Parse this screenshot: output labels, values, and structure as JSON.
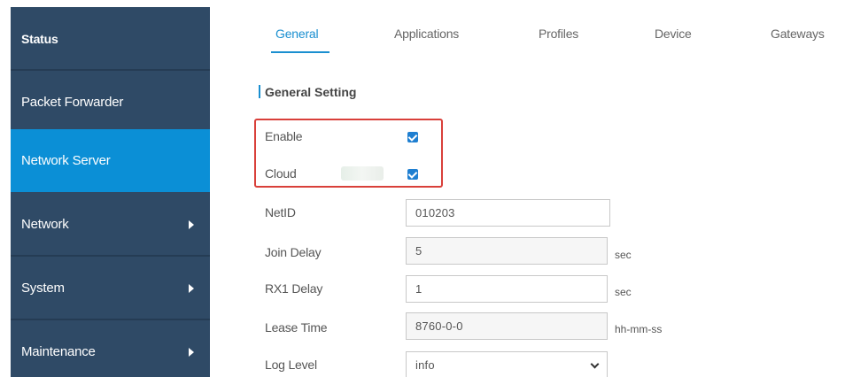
{
  "sidebar": {
    "items": [
      {
        "label": "Status"
      },
      {
        "label": "Packet Forwarder"
      },
      {
        "label": "Network Server"
      },
      {
        "label": "Network"
      },
      {
        "label": "System"
      },
      {
        "label": "Maintenance"
      }
    ]
  },
  "tabs": [
    "General",
    "Applications",
    "Profiles",
    "Device",
    "Gateways"
  ],
  "section": {
    "title": "General Setting"
  },
  "form": {
    "enable": {
      "label": "Enable",
      "checked": true
    },
    "cloud": {
      "label": "Cloud",
      "checked": true
    },
    "netid": {
      "label": "NetID",
      "value": "010203"
    },
    "join_delay": {
      "label": "Join Delay",
      "value": "5",
      "unit": "sec"
    },
    "rx1_delay": {
      "label": "RX1 Delay",
      "value": "1",
      "unit": "sec"
    },
    "lease_time": {
      "label": "Lease Time",
      "value": "8760-0-0",
      "unit": "hh-mm-ss"
    },
    "log_level": {
      "label": "Log Level",
      "value": "info"
    }
  },
  "colors": {
    "sidebar_bg": "#2f4a66",
    "sidebar_active": "#0b8fd6",
    "accent": "#1a8fd0",
    "highlight_border": "#d9403a"
  }
}
